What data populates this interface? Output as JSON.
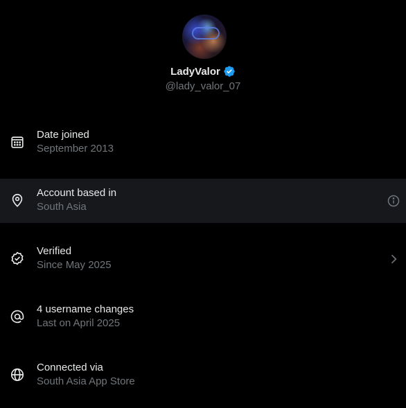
{
  "profile": {
    "display_name": "LadyValor",
    "handle": "@lady_valor_07",
    "verified_color": "#1d9bf0"
  },
  "items": [
    {
      "icon": "calendar-icon",
      "title": "Date joined",
      "subtitle": "September 2013"
    },
    {
      "icon": "location-pin-icon",
      "title": "Account based in",
      "subtitle": "South Asia",
      "trailing_icon": "info-icon"
    },
    {
      "icon": "verified-check-icon",
      "title": "Verified",
      "subtitle": "Since May 2025",
      "trailing_icon": "chevron-right-icon"
    },
    {
      "icon": "at-sign-icon",
      "title": "4 username changes",
      "subtitle": "Last on April 2025"
    },
    {
      "icon": "globe-icon",
      "title": "Connected via",
      "subtitle": "South Asia App Store"
    }
  ],
  "colors": {
    "background": "#000000",
    "highlight_row": "#16181c",
    "primary_text": "#e7e9ea",
    "secondary_text": "#71767b"
  }
}
